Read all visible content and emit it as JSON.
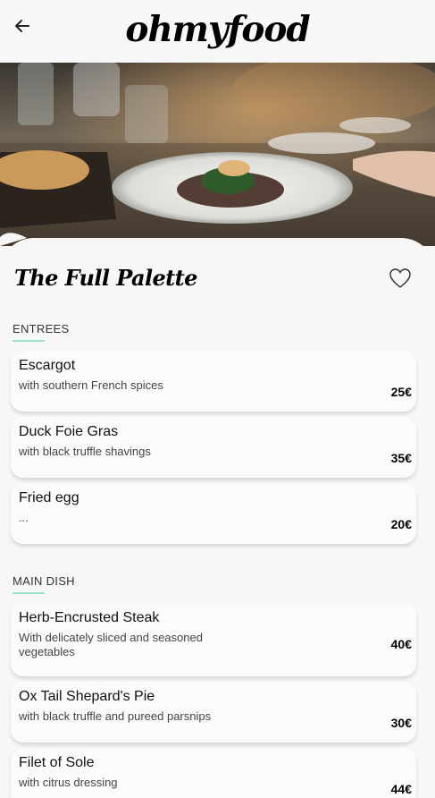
{
  "app": {
    "logo_text": "ohmyfood"
  },
  "icons": {
    "back": "arrow-left-icon",
    "favorite": "heart-outline-icon"
  },
  "colors": {
    "accent": "#99e2d0",
    "background": "#f6f6f6",
    "text": "#111111"
  },
  "restaurant": {
    "name": "The Full Palette"
  },
  "sections": [
    {
      "title": "ENTREES",
      "dishes": [
        {
          "name": "Escargot",
          "description": "with southern French spices",
          "price": "25€"
        },
        {
          "name": "Duck Foie Gras",
          "description": "with black truffle shavings",
          "price": "35€"
        },
        {
          "name": "Fried egg",
          "description": "...",
          "price": "20€"
        }
      ]
    },
    {
      "title": "MAIN DISH",
      "dishes": [
        {
          "name": "Herb-Encrusted Steak",
          "description": "With delicately sliced and seasoned vegetables",
          "price": "40€"
        },
        {
          "name": "Ox Tail Shepard's Pie",
          "description": "with black truffle and pureed parsnips",
          "price": "30€"
        },
        {
          "name": "Filet of Sole",
          "description": "with citrus dressing",
          "price": "44€"
        }
      ]
    }
  ]
}
